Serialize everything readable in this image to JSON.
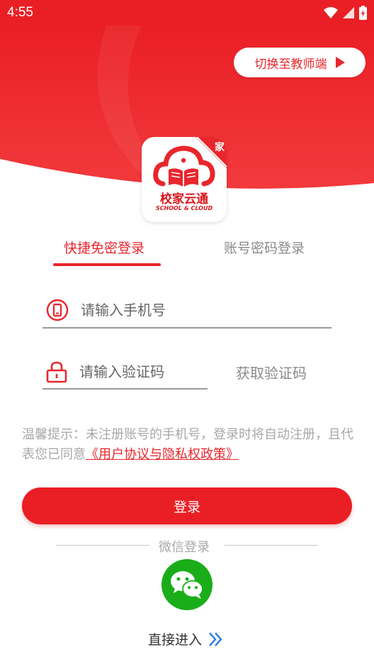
{
  "status_bar": {
    "time": "4:55"
  },
  "header": {
    "switch_label": "切换至教师端",
    "bg_color": "#ea1f25"
  },
  "logo": {
    "badge": "家",
    "brand": "校家云通",
    "brand_en": "SCHOOL & CLOUD"
  },
  "tabs": [
    {
      "label": "快捷免密登录",
      "active": true
    },
    {
      "label": "账号密码登录",
      "active": false
    }
  ],
  "form": {
    "phone": {
      "placeholder": "请输入手机号",
      "value": "",
      "icon": "phone-icon"
    },
    "code": {
      "placeholder": "请输入验证码",
      "value": "",
      "icon": "lock-icon"
    },
    "get_code_label": "获取验证码"
  },
  "notice": {
    "text": "温馨提示：未注册账号的手机号，登录时将自动注册，且代表您已同意",
    "agreement_link": "《用户协议与隐私权政策》"
  },
  "login_label": "登录",
  "wechat": {
    "label": "微信登录",
    "icon": "wechat-icon",
    "color": "#1aad19"
  },
  "enter": {
    "label": "直接进入",
    "icon": "double-chevron-right-icon"
  },
  "colors": {
    "accent": "#e8262c",
    "muted": "#a8a8a8"
  }
}
